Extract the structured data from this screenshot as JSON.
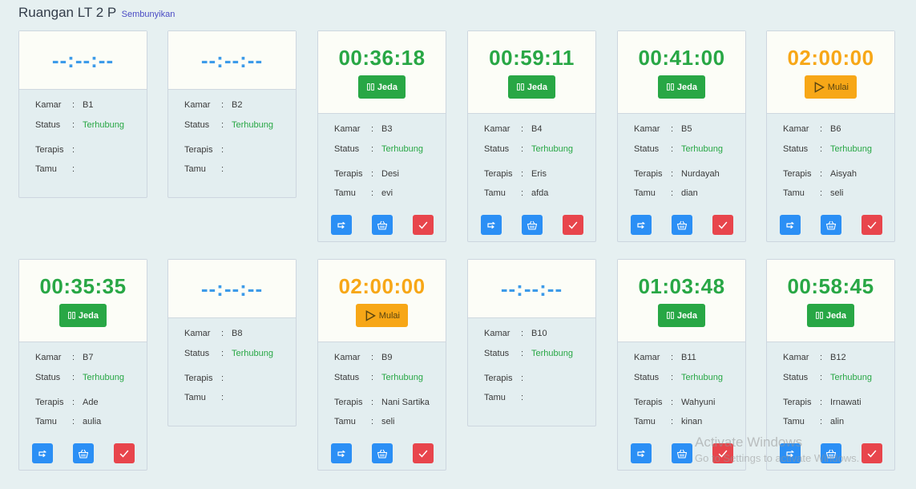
{
  "header": {
    "title": "Ruangan LT 2 P",
    "hide_link": "Sembunyikan"
  },
  "labels": {
    "kamar": "Kamar",
    "status": "Status",
    "terapis": "Terapis",
    "tamu": "Tamu",
    "colon": ":"
  },
  "cards": [
    {
      "timer": "--:--:--",
      "state": "empty",
      "kamar": "B1",
      "status": "Terhubung",
      "terapis": "",
      "tamu": ""
    },
    {
      "timer": "--:--:--",
      "state": "empty",
      "kamar": "B2",
      "status": "Terhubung",
      "terapis": "",
      "tamu": ""
    },
    {
      "timer": "00:36:18",
      "state": "running",
      "button": "Jeda",
      "kamar": "B3",
      "status": "Terhubung",
      "terapis": "Desi",
      "tamu": "evi"
    },
    {
      "timer": "00:59:11",
      "state": "running",
      "button": "Jeda",
      "kamar": "B4",
      "status": "Terhubung",
      "terapis": "Eris",
      "tamu": "afda"
    },
    {
      "timer": "00:41:00",
      "state": "running",
      "button": "Jeda",
      "kamar": "B5",
      "status": "Terhubung",
      "terapis": "Nurdayah",
      "tamu": "dian"
    },
    {
      "timer": "02:00:00",
      "state": "ready",
      "button": "Mulai",
      "kamar": "B6",
      "status": "Terhubung",
      "terapis": "Aisyah",
      "tamu": "seli"
    },
    {
      "timer": "00:35:35",
      "state": "running",
      "button": "Jeda",
      "kamar": "B7",
      "status": "Terhubung",
      "terapis": "Ade",
      "tamu": "aulia"
    },
    {
      "timer": "--:--:--",
      "state": "empty",
      "kamar": "B8",
      "status": "Terhubung",
      "terapis": "",
      "tamu": ""
    },
    {
      "timer": "02:00:00",
      "state": "ready",
      "button": "Mulai",
      "kamar": "B9",
      "status": "Terhubung",
      "terapis": "Nani Sartika",
      "tamu": "seli"
    },
    {
      "timer": "--:--:--",
      "state": "empty",
      "kamar": "B10",
      "status": "Terhubung",
      "terapis": "",
      "tamu": ""
    },
    {
      "timer": "01:03:48",
      "state": "running",
      "button": "Jeda",
      "kamar": "B11",
      "status": "Terhubung",
      "terapis": "Wahyuni",
      "tamu": "kinan"
    },
    {
      "timer": "00:58:45",
      "state": "running",
      "button": "Jeda",
      "kamar": "B12",
      "status": "Terhubung",
      "terapis": "Irnawati",
      "tamu": "alin"
    }
  ],
  "watermark": {
    "line1": "Activate Windows",
    "line2": "Go to Settings to activate Windows."
  },
  "colors": {
    "running": "#28a745",
    "ready": "#f7a717",
    "empty": "#3d9be9",
    "action_blue": "#2b8ff5",
    "action_red": "#e8454c"
  },
  "icons": {
    "pause": "pause-icon",
    "play": "play-icon",
    "swap": "swap-icon",
    "basket": "basket-icon",
    "check": "check-icon"
  }
}
